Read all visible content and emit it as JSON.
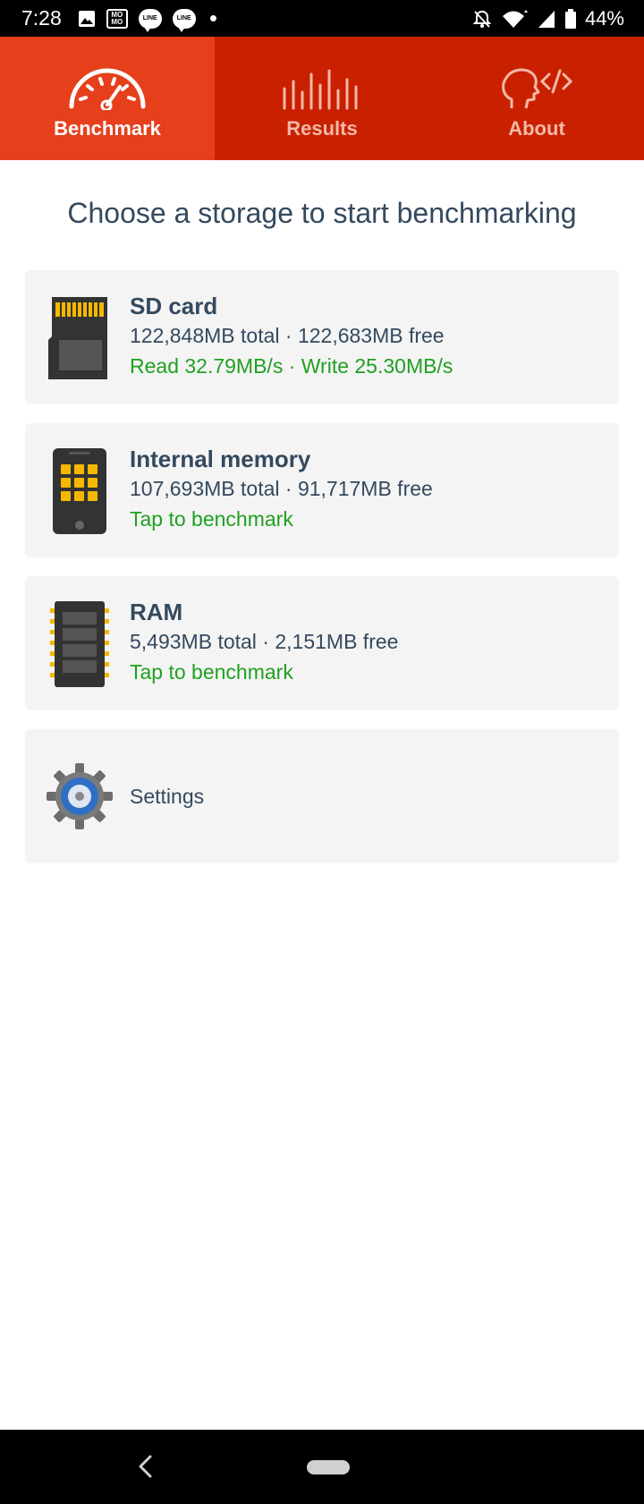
{
  "status_bar": {
    "time": "7:28",
    "battery": "44%",
    "icons": [
      "image-icon",
      "mo-icon",
      "line-icon",
      "line-icon",
      "notification-dot",
      "mute-icon",
      "wifi-icon",
      "signal-icon",
      "battery-icon"
    ],
    "mo_text": "MO MO",
    "line_text": "LINE"
  },
  "tabs": [
    {
      "label": "Benchmark",
      "icon": "speedometer-icon",
      "active": true
    },
    {
      "label": "Results",
      "icon": "bars-icon",
      "active": false
    },
    {
      "label": "About",
      "icon": "head-code-icon",
      "active": false
    }
  ],
  "heading": "Choose a storage to start benchmarking",
  "storages": [
    {
      "title": "SD card",
      "capacity": "122,848MB total · 122,683MB free",
      "status": "Read 32.79MB/s · Write 25.30MB/s",
      "icon": "sd-card-icon"
    },
    {
      "title": "Internal memory",
      "capacity": "107,693MB total · 91,717MB free",
      "status": "Tap to benchmark",
      "icon": "phone-icon"
    },
    {
      "title": "RAM",
      "capacity": "5,493MB total · 2,151MB free",
      "status": "Tap to benchmark",
      "icon": "ram-chip-icon"
    }
  ],
  "settings": {
    "label": "Settings",
    "icon": "gear-icon"
  },
  "colors": {
    "tab_bar": "#c92100",
    "tab_active": "#e63f1c",
    "text": "#34495e",
    "status_green": "#20a020",
    "card_bg": "#f4f4f4",
    "chip_yellow": "#f5b800"
  }
}
